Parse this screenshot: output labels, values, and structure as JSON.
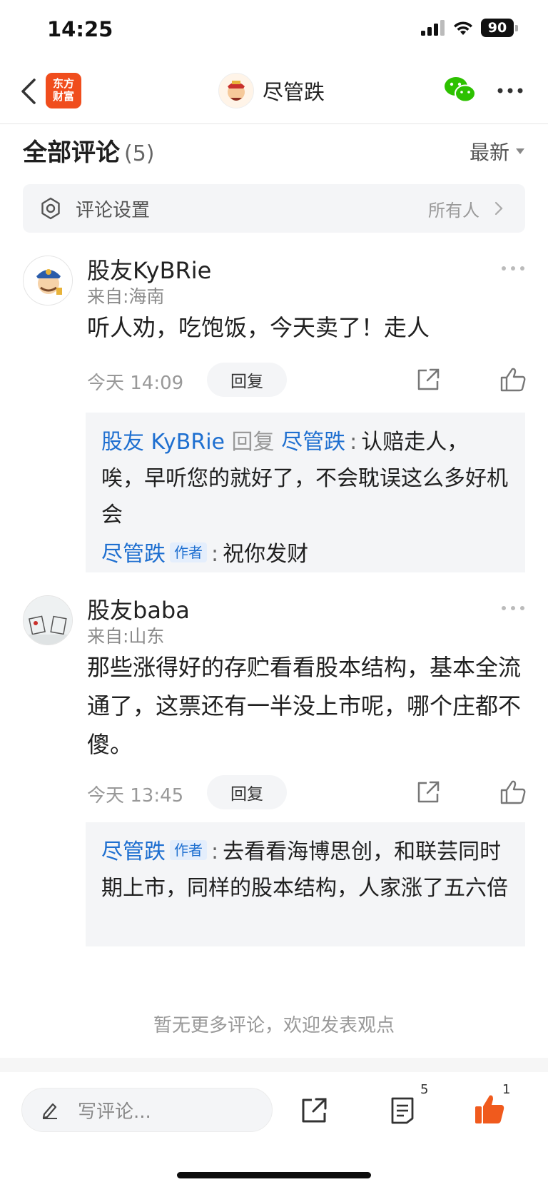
{
  "status": {
    "time": "14:25",
    "battery": "90"
  },
  "nav": {
    "logo_line1": "东方",
    "logo_line2": "财富",
    "title": "尽管跌"
  },
  "section": {
    "title": "全部评论",
    "count": "(5)",
    "sort": "最新"
  },
  "settings": {
    "label": "评论设置",
    "value": "所有人"
  },
  "comments": [
    {
      "user": "股友KyBRie",
      "location": "来自:海南",
      "text": "听人劝，吃饱饭，今天卖了！走人",
      "time": "今天 14:09",
      "reply_label": "回复",
      "replies": [
        {
          "from": "股友 KyBRie",
          "verb": "回复",
          "to": "尽管跌",
          "text": "认赔走人，唉，早听您的就好了，不会耽误这么多好机会"
        },
        {
          "from": "尽管跌",
          "tag": "作者",
          "text": "祝你发财"
        }
      ]
    },
    {
      "user": "股友baba",
      "location": "来自:山东",
      "text": "那些涨得好的存贮看看股本结构，基本全流通了，这票还有一半没上市呢，哪个庄都不傻。",
      "time": "今天 13:45",
      "reply_label": "回复",
      "replies": [
        {
          "from": "尽管跌",
          "tag": "作者",
          "text": "去看看海博思创，和联芸同时期上市，同样的股本结构，人家涨了五六倍"
        }
      ]
    }
  ],
  "footer_note": "暂无更多评论，欢迎发表观点",
  "bottom_bar": {
    "input_placeholder": "写评论...",
    "comment_count": "5",
    "like_count": "1"
  },
  "colors": {
    "brand": "#f04d1d",
    "link_blue": "#1e6fd0",
    "wechat_green": "#2dc100",
    "like_orange": "#f05a1d"
  }
}
